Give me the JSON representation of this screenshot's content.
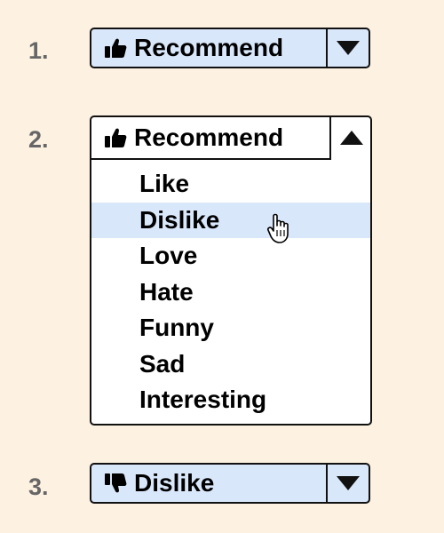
{
  "colors": {
    "background": "#fdf1e1",
    "button_fill": "#d9e7fb",
    "highlight": "#d9e7fb",
    "step_number": "#666666",
    "border": "#111111"
  },
  "steps": [
    {
      "number": "1.",
      "button_label": "Recommend",
      "icon": "thumbs-up-icon",
      "caret": "caret-down-icon"
    },
    {
      "number": "2.",
      "button_label": "Recommend",
      "icon": "thumbs-up-icon",
      "caret": "caret-up-icon",
      "menu_items": [
        "Like",
        "Dislike",
        "Love",
        "Hate",
        "Funny",
        "Sad",
        "Interesting"
      ],
      "hovered_item": "Dislike",
      "pointer": "hand-pointer-icon"
    },
    {
      "number": "3.",
      "button_label": "Dislike",
      "icon": "thumbs-down-icon",
      "caret": "caret-down-icon"
    }
  ]
}
